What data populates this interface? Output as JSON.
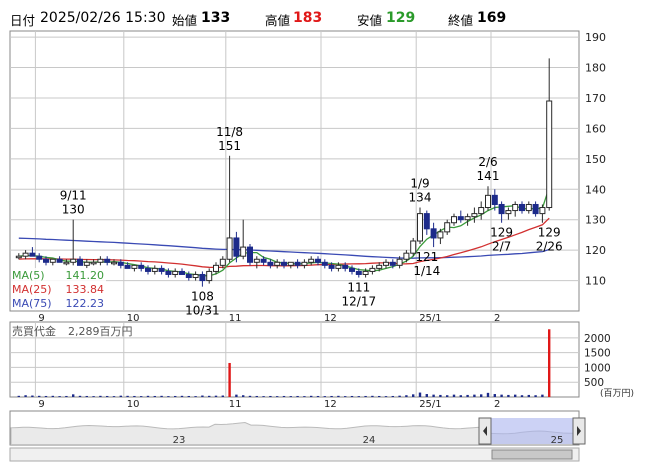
{
  "header": {
    "date_label": "日付",
    "datetime": "2025/02/26 15:30",
    "open_label": "始値",
    "open": "133",
    "high_label": "高値",
    "high": "183",
    "low_label": "安値",
    "low": "129",
    "close_label": "終値",
    "close": "169"
  },
  "colors": {
    "up": "#2a2a2a",
    "down": "#1c2a8a",
    "ma5": "#3a9a3a",
    "ma25": "#d23030",
    "ma75": "#3a4ab4",
    "grid": "#c8c8c8",
    "volume": "#1c2a8a",
    "volume_spike": "#e01818"
  },
  "ma_legend": [
    {
      "label": "MA(5)",
      "value": "141.20"
    },
    {
      "label": "MA(25)",
      "value": "133.84"
    },
    {
      "label": "MA(75)",
      "value": "122.23"
    }
  ],
  "volume_panel": {
    "title": "売買代金",
    "value": "2,289百万円",
    "unit": "(百万円)",
    "ticks": [
      "2000",
      "1500",
      "1000",
      "500"
    ]
  },
  "navigator": {
    "year_labels": [
      "23",
      "24",
      "25"
    ]
  },
  "chart_data": {
    "type": "candlestick",
    "y_ticks": [
      110,
      120,
      130,
      140,
      150,
      160,
      170,
      180,
      190
    ],
    "ylim": [
      100,
      192
    ],
    "x_tick_labels": [
      "9",
      "10",
      "11",
      "12",
      "25/1",
      "2"
    ],
    "annotations": [
      {
        "date": "9/11",
        "value": "130"
      },
      {
        "date": "11/8",
        "value": "151"
      },
      {
        "date": "1/9",
        "value": "134"
      },
      {
        "date": "2/6",
        "value": "141"
      },
      {
        "date": "10/31",
        "value": "108"
      },
      {
        "date": "12/17",
        "value": "111"
      },
      {
        "date": "1/14",
        "value": "121"
      },
      {
        "date": "2/7",
        "value": "129"
      },
      {
        "date": "2/26",
        "value": "129"
      }
    ],
    "candles": [
      [
        118,
        119,
        117,
        118
      ],
      [
        118,
        120,
        117,
        119
      ],
      [
        119,
        121,
        118,
        118
      ],
      [
        118,
        119,
        116,
        117
      ],
      [
        117,
        118,
        115,
        116
      ],
      [
        116,
        117,
        115,
        117
      ],
      [
        117,
        118,
        116,
        116
      ],
      [
        116,
        117,
        115,
        116
      ],
      [
        116,
        130,
        115,
        117
      ],
      [
        117,
        118,
        115,
        115
      ],
      [
        115,
        117,
        114,
        116
      ],
      [
        116,
        117,
        115,
        116
      ],
      [
        116,
        118,
        115,
        117
      ],
      [
        117,
        118,
        115,
        116
      ],
      [
        116,
        117,
        115,
        116
      ],
      [
        116,
        117,
        114,
        115
      ],
      [
        115,
        116,
        114,
        114
      ],
      [
        114,
        115,
        113,
        115
      ],
      [
        115,
        116,
        113,
        114
      ],
      [
        114,
        115,
        112,
        113
      ],
      [
        113,
        115,
        112,
        114
      ],
      [
        114,
        115,
        112,
        113
      ],
      [
        113,
        114,
        111,
        112
      ],
      [
        112,
        114,
        111,
        113
      ],
      [
        113,
        114,
        112,
        112
      ],
      [
        112,
        113,
        110,
        111
      ],
      [
        111,
        113,
        110,
        112
      ],
      [
        112,
        113,
        108,
        110
      ],
      [
        110,
        114,
        109,
        113
      ],
      [
        113,
        116,
        112,
        115
      ],
      [
        115,
        118,
        114,
        117
      ],
      [
        117,
        151,
        116,
        124
      ],
      [
        124,
        126,
        116,
        118
      ],
      [
        118,
        130,
        117,
        121
      ],
      [
        121,
        122,
        115,
        116
      ],
      [
        116,
        118,
        114,
        117
      ],
      [
        117,
        118,
        115,
        116
      ],
      [
        116,
        117,
        114,
        115
      ],
      [
        115,
        117,
        114,
        116
      ],
      [
        116,
        117,
        114,
        115
      ],
      [
        115,
        116,
        114,
        116
      ],
      [
        116,
        117,
        114,
        115
      ],
      [
        115,
        117,
        114,
        116
      ],
      [
        116,
        118,
        115,
        117
      ],
      [
        117,
        118,
        115,
        116
      ],
      [
        116,
        117,
        114,
        115
      ],
      [
        115,
        116,
        113,
        114
      ],
      [
        114,
        116,
        113,
        115
      ],
      [
        115,
        116,
        113,
        114
      ],
      [
        114,
        115,
        112,
        113
      ],
      [
        113,
        114,
        111,
        112
      ],
      [
        112,
        114,
        111,
        113
      ],
      [
        113,
        115,
        112,
        114
      ],
      [
        114,
        116,
        113,
        115
      ],
      [
        115,
        117,
        114,
        116
      ],
      [
        116,
        117,
        114,
        115
      ],
      [
        115,
        118,
        114,
        117
      ],
      [
        117,
        120,
        116,
        119
      ],
      [
        119,
        124,
        118,
        123
      ],
      [
        123,
        134,
        122,
        132
      ],
      [
        132,
        133,
        125,
        127
      ],
      [
        127,
        129,
        121,
        124
      ],
      [
        124,
        127,
        122,
        126
      ],
      [
        126,
        130,
        125,
        129
      ],
      [
        129,
        132,
        128,
        131
      ],
      [
        131,
        133,
        129,
        130
      ],
      [
        130,
        132,
        128,
        131
      ],
      [
        131,
        134,
        129,
        132
      ],
      [
        132,
        136,
        130,
        134
      ],
      [
        134,
        141,
        133,
        138
      ],
      [
        138,
        140,
        133,
        135
      ],
      [
        135,
        136,
        129,
        132
      ],
      [
        132,
        134,
        130,
        133
      ],
      [
        133,
        136,
        131,
        135
      ],
      [
        135,
        136,
        132,
        133
      ],
      [
        133,
        136,
        132,
        135
      ],
      [
        135,
        136,
        131,
        132
      ],
      [
        132,
        135,
        129,
        134
      ],
      [
        134,
        183,
        133,
        169
      ]
    ],
    "volume": [
      40,
      60,
      50,
      40,
      35,
      40,
      30,
      35,
      90,
      40,
      35,
      30,
      40,
      35,
      30,
      45,
      40,
      35,
      30,
      40,
      35,
      40,
      30,
      35,
      40,
      35,
      30,
      50,
      40,
      45,
      50,
      1150,
      80,
      60,
      40,
      35,
      30,
      35,
      30,
      35,
      30,
      35,
      30,
      40,
      35,
      30,
      35,
      40,
      30,
      35,
      30,
      35,
      40,
      35,
      30,
      35,
      45,
      60,
      90,
      150,
      100,
      80,
      70,
      60,
      80,
      60,
      70,
      80,
      90,
      140,
      100,
      80,
      70,
      80,
      60,
      70,
      60,
      80,
      2289
    ]
  }
}
